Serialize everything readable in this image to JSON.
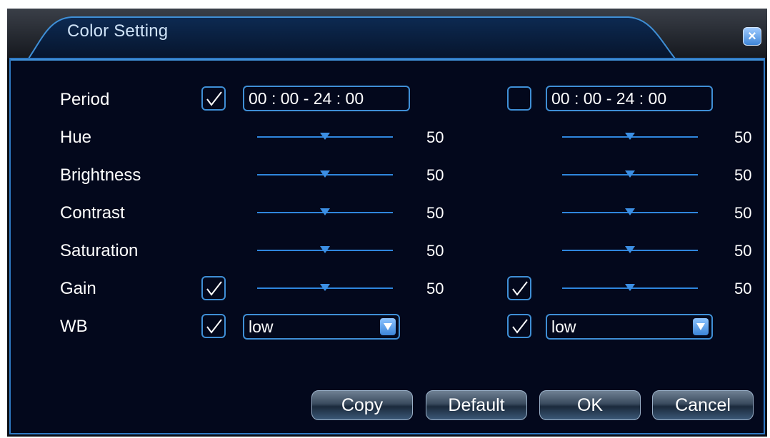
{
  "window": {
    "title": "Color Setting",
    "close_icon": "close-icon"
  },
  "labels": {
    "period": "Period",
    "hue": "Hue",
    "brightness": "Brightness",
    "contrast": "Contrast",
    "saturation": "Saturation",
    "gain": "Gain",
    "wb": "WB"
  },
  "period1": {
    "enabled": true,
    "time": "00 : 00 - 24 : 00"
  },
  "period2": {
    "enabled": false,
    "time": "00 : 00 - 24 : 00"
  },
  "col1": {
    "hue": "50",
    "brightness": "50",
    "contrast": "50",
    "saturation": "50",
    "gain": "50",
    "gain_enabled": true,
    "wb_enabled": true,
    "wb": "low"
  },
  "col2": {
    "hue": "50",
    "brightness": "50",
    "contrast": "50",
    "saturation": "50",
    "gain": "50",
    "gain_enabled": true,
    "wb_enabled": true,
    "wb": "low"
  },
  "slider_level": 0.5,
  "buttons": {
    "copy": "Copy",
    "default": "Default",
    "ok": "OK",
    "cancel": "Cancel"
  },
  "colors": {
    "accent": "#3f8fd6",
    "background": "#03081c",
    "text": "#ffffff"
  }
}
